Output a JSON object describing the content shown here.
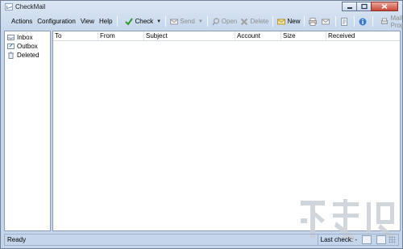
{
  "window": {
    "title": "CheckMail"
  },
  "menu": [
    "Actions",
    "Configuration",
    "View",
    "Help"
  ],
  "toolbar": {
    "check": "Check",
    "send": "Send",
    "open": "Open",
    "delete": "Delete",
    "new": "New",
    "mail_program": "Mail Program"
  },
  "folders": [
    "Inbox",
    "Outbox",
    "Deleted"
  ],
  "columns": [
    "To",
    "From",
    "Subject",
    "Account",
    "Size",
    "Received"
  ],
  "status": {
    "left": "Ready",
    "last_check": "Last check: -"
  },
  "watermark": "下载吧",
  "icons": {
    "check": "checkmark-icon",
    "send": "envelope-send-icon",
    "open": "search-open-icon",
    "delete": "delete-x-icon",
    "new": "new-message-icon",
    "print": "printer-icon",
    "mail": "envelope-icon",
    "info": "info-icon",
    "mail_program": "mail-program-icon"
  },
  "colors": {
    "accent": "#3a7bd5",
    "check_green": "#2e9a2e",
    "delete_red": "#c0392b"
  }
}
